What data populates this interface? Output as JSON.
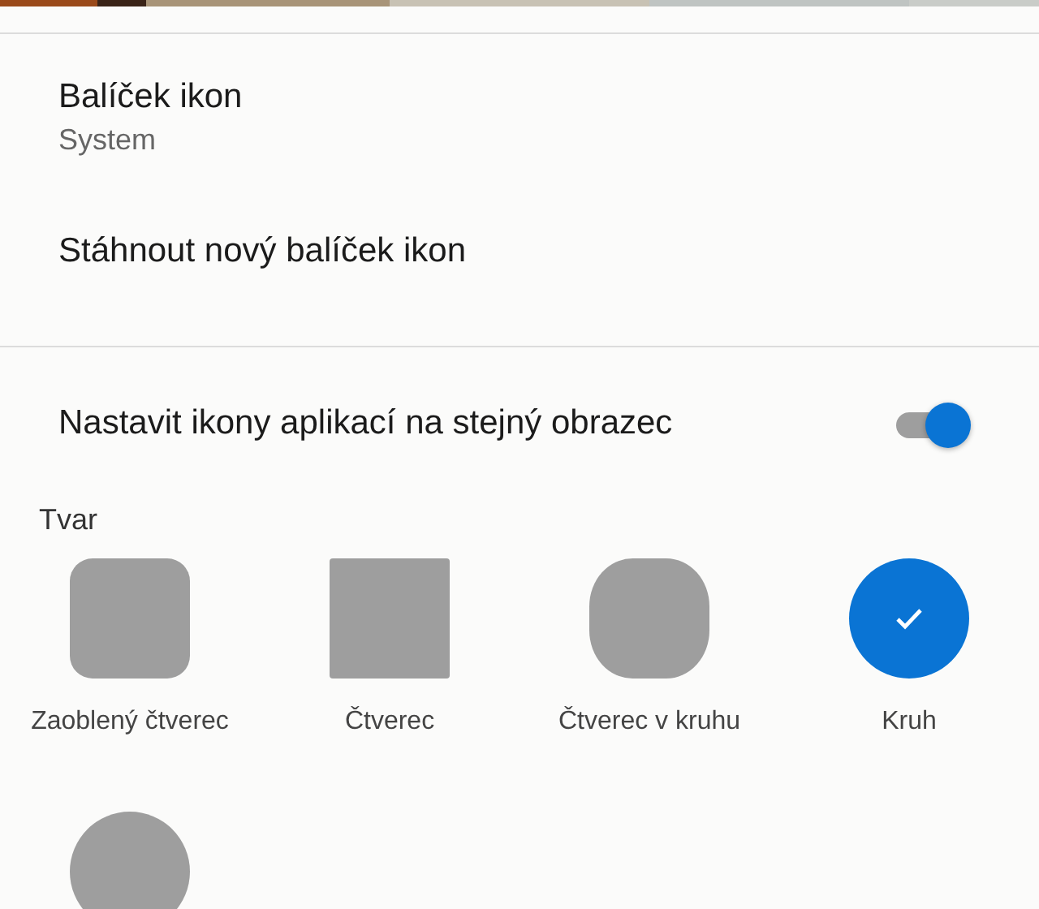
{
  "icon_pack": {
    "title": "Balíček ikon",
    "value": "System"
  },
  "download_link": {
    "label": "Stáhnout nový balíček ikon"
  },
  "uniform_shape": {
    "label": "Nastavit ikony aplikací na stejný obrazec",
    "on": true
  },
  "shape_section": {
    "title": "Tvar"
  },
  "shapes": [
    {
      "kind": "rounded",
      "label": "Zaoblený čtverec",
      "selected": false
    },
    {
      "kind": "square",
      "label": "Čtverec",
      "selected": false
    },
    {
      "kind": "squircle",
      "label": "Čtverec v kruhu",
      "selected": false
    },
    {
      "kind": "circle",
      "label": "Kruh",
      "selected": true
    },
    {
      "kind": "circle",
      "selected": false
    }
  ]
}
